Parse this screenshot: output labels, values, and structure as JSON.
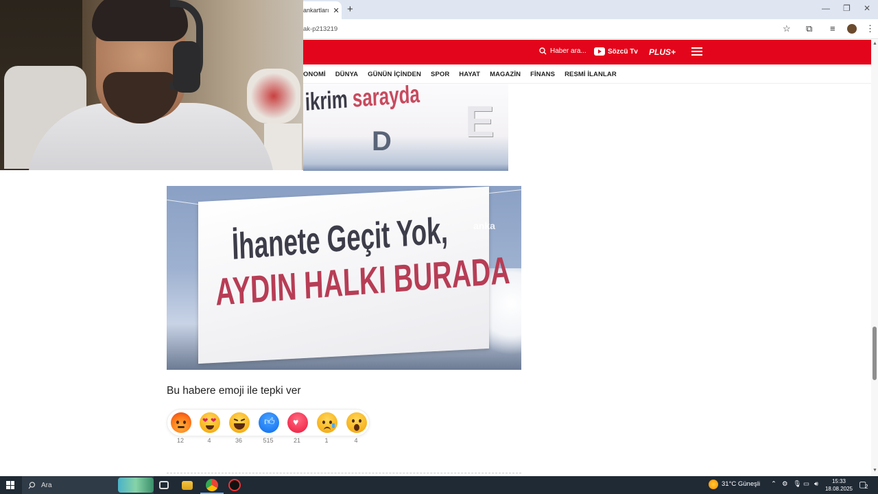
{
  "browser": {
    "tab_title": "ankartları",
    "url": "ak-p213219",
    "new_tab": "+",
    "tab_close": "✕"
  },
  "site": {
    "search_label": "Haber ara...",
    "tv_label": "Sözcü Tv",
    "plus_label": "PLUS+",
    "nav": [
      "ONOMİ",
      "DÜNYA",
      "GÜNÜN İÇİNDEN",
      "SPOR",
      "HAYAT",
      "MAGAZİN",
      "FİNANS",
      "RESMİ İLANLAR"
    ]
  },
  "article": {
    "image1_caption_dark": "ikrim ",
    "image1_caption_red": "sarayda",
    "image2_line1": "İhanete Geçit Yok,",
    "image2_line2": "AYDIN HALKI BURADA",
    "image2_watermark": "anka",
    "reaction_title": "Bu habere emoji ile tepki ver",
    "reactions": [
      {
        "icon": "angry-face-icon",
        "count": "12"
      },
      {
        "icon": "heart-eyes-icon",
        "count": "4"
      },
      {
        "icon": "laughing-face-icon",
        "count": "36"
      },
      {
        "icon": "thumbs-up-icon",
        "count": "515"
      },
      {
        "icon": "heart-icon",
        "count": "21"
      },
      {
        "icon": "sad-face-icon",
        "count": "1"
      },
      {
        "icon": "surprised-face-icon",
        "count": "4"
      }
    ]
  },
  "taskbar": {
    "search_placeholder": "Ara",
    "weather": "31°C  Güneşli",
    "time": "15:33",
    "date": "18.08.2025",
    "notifications": "2"
  },
  "colors": {
    "brand_red": "#e3051b",
    "taskbar": "#1f2a35"
  }
}
